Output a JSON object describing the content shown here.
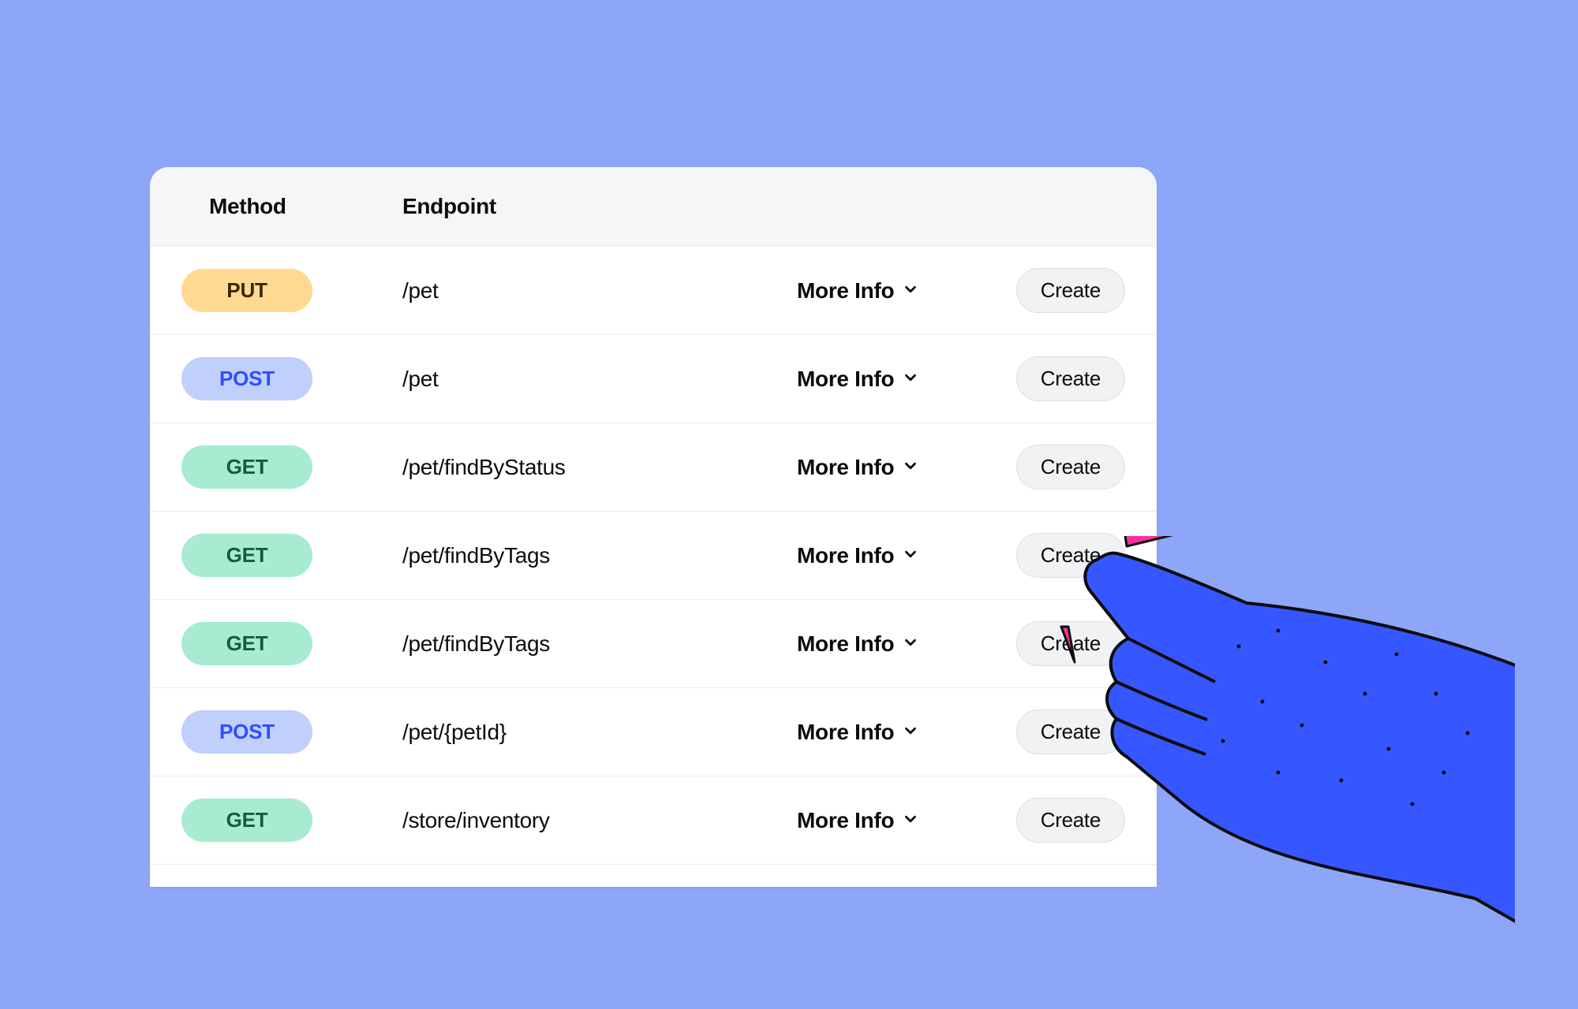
{
  "table": {
    "columns": {
      "method": "Method",
      "endpoint": "Endpoint"
    },
    "more_info_label": "More Info",
    "create_label": "Create",
    "rows": [
      {
        "method": "PUT",
        "method_class": "method-put",
        "endpoint": "/pet"
      },
      {
        "method": "POST",
        "method_class": "method-post",
        "endpoint": "/pet"
      },
      {
        "method": "GET",
        "method_class": "method-get",
        "endpoint": "/pet/findByStatus"
      },
      {
        "method": "GET",
        "method_class": "method-get",
        "endpoint": "/pet/findByTags"
      },
      {
        "method": "GET",
        "method_class": "method-get",
        "endpoint": "/pet/findByTags"
      },
      {
        "method": "POST",
        "method_class": "method-post",
        "endpoint": "/pet/{petId}"
      },
      {
        "method": "GET",
        "method_class": "method-get",
        "endpoint": "/store/inventory"
      }
    ]
  },
  "colors": {
    "bg": "#8ea6f8",
    "hand": "#3657ff",
    "accent": "#ff2fa0"
  }
}
